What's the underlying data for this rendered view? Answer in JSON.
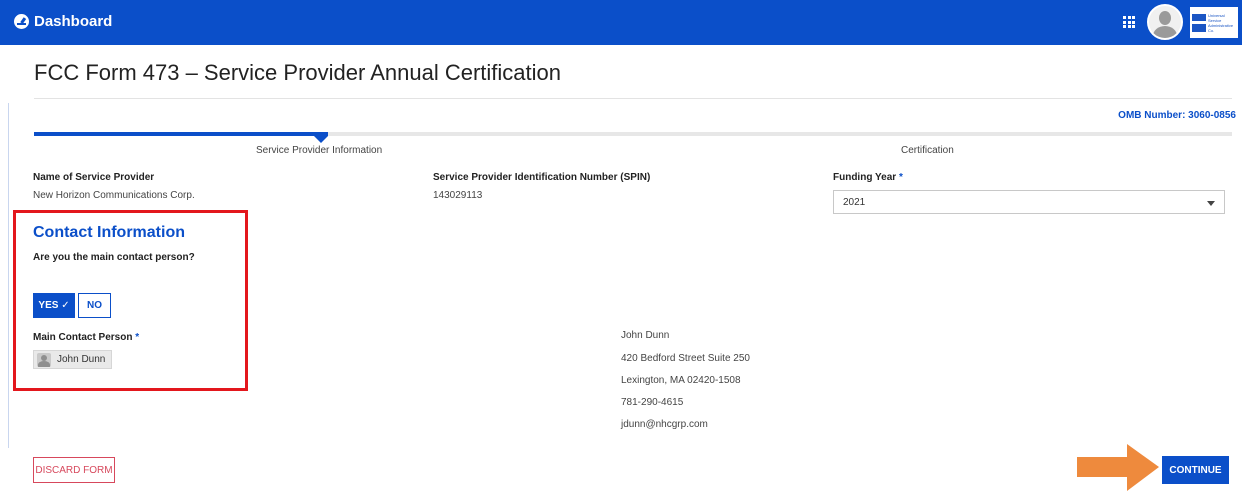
{
  "header": {
    "dashboard_label": "Dashboard",
    "logo_text": "Universal Service Administrative Co."
  },
  "page": {
    "title": "FCC Form 473 – Service Provider Annual Certification",
    "omb": "OMB Number: 3060-0856"
  },
  "steps": {
    "items": [
      "Service Provider Information",
      "Certification"
    ],
    "active_index": 0
  },
  "fields": {
    "provider_name_label": "Name of Service Provider",
    "provider_name_value": "New Horizon Communications Corp.",
    "spin_label": "Service Provider Identification Number (SPIN)",
    "spin_value": "143029113",
    "funding_year_label": "Funding Year",
    "funding_year_value": "2021",
    "required_marker": "*"
  },
  "contact": {
    "heading": "Contact Information",
    "question": "Are you the main contact person?",
    "yes_label": "YES ✓",
    "no_label": "NO",
    "selected": "YES",
    "main_contact_label": "Main Contact Person",
    "main_contact_value": "John Dunn"
  },
  "address": {
    "name": "John Dunn",
    "street": "420 Bedford Street Suite 250",
    "city": "Lexington, MA 02420-1508",
    "phone": "781-290-4615",
    "email": "jdunn@nhcgrp.com"
  },
  "actions": {
    "discard_label": "DISCARD FORM",
    "continue_label": "CONTINUE"
  },
  "colors": {
    "primary": "#0b4fc9",
    "highlight": "#e3171d",
    "arrow": "#ee8a3d",
    "discard": "#d7485c"
  },
  "icons": [
    "dashboard-icon",
    "apps-grid-icon",
    "user-avatar-icon",
    "usac-logo",
    "caret-down-icon",
    "user-icon",
    "arrow-right-icon"
  ]
}
